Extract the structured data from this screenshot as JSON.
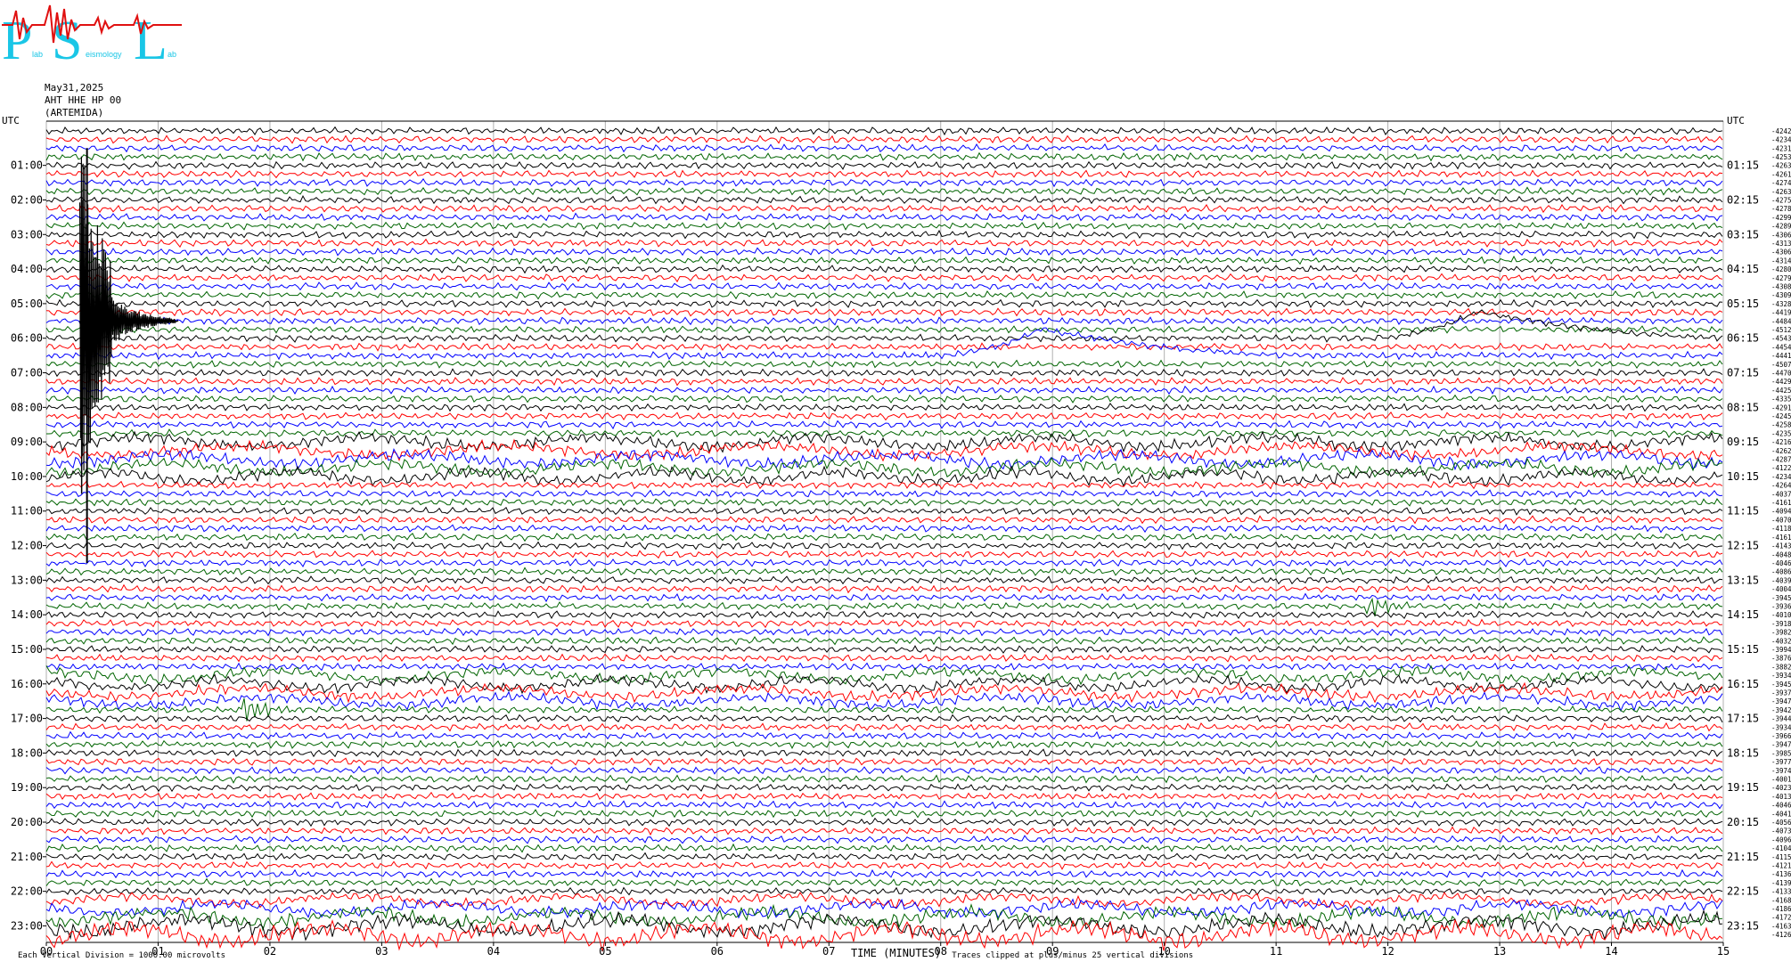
{
  "logo": {
    "big_letters": [
      "P",
      "S",
      "L"
    ],
    "small_text": [
      "lab",
      "eismology",
      "ab"
    ]
  },
  "header": {
    "date": "May31,2025",
    "station": "AHT HHE HP 00",
    "site": "(ARTEMIDA)"
  },
  "chart_data": {
    "type": "line",
    "title": "",
    "left_axis_title": "UTC",
    "right_axis_title": "UTC",
    "xlabel": "TIME (MINUTES)",
    "xlim": [
      0,
      15
    ],
    "x_ticks": [
      "00",
      "01",
      "02",
      "03",
      "04",
      "05",
      "06",
      "07",
      "08",
      "09",
      "10",
      "11",
      "12",
      "13",
      "14",
      "15"
    ],
    "hours": [
      "01:00",
      "02:00",
      "03:00",
      "04:00",
      "05:00",
      "06:00",
      "07:00",
      "08:00",
      "09:00",
      "10:00",
      "11:00",
      "12:00",
      "13:00",
      "14:00",
      "15:00",
      "16:00",
      "17:00",
      "18:00",
      "19:00",
      "20:00",
      "21:00",
      "22:00",
      "23:00"
    ],
    "right_hours": [
      "01:15",
      "02:15",
      "03:15",
      "04:15",
      "05:15",
      "06:15",
      "07:15",
      "08:15",
      "09:15",
      "10:15",
      "11:15",
      "12:15",
      "13:15",
      "14:15",
      "15:15",
      "16:15",
      "17:15",
      "18:15",
      "19:15",
      "20:15",
      "21:15",
      "22:15",
      "23:15"
    ],
    "trace_offsets": [
      -4242,
      -4234,
      -4231,
      -4253,
      -4263,
      -4261,
      -4274,
      -4263,
      -4275,
      -4278,
      -4299,
      -4289,
      -4306,
      -4313,
      -4306,
      -4314,
      -4280,
      -4279,
      -4308,
      -4309,
      -4328,
      -4419,
      -4484,
      -4512,
      -4543,
      -4454,
      -4441,
      -4507,
      -4470,
      -4429,
      -4425,
      -4335,
      -4291,
      -4245,
      -4258,
      -4235,
      -4216,
      -4262,
      -4287,
      -4122,
      -4234,
      -4264,
      -4037,
      -4161,
      -4094,
      -4070,
      -4118,
      -4161,
      -4143,
      -4048,
      -4046,
      -4086,
      -4039,
      -4004,
      -3945,
      -3936,
      -4010,
      -3918,
      -3982,
      -4032,
      -3994,
      -3876,
      -3882,
      -3934,
      -3945,
      -3937,
      -3947,
      -3942,
      -3944,
      -3934,
      -3966,
      -3947,
      -3985,
      -3977,
      -3974,
      -4001,
      -4023,
      -4013,
      -4046,
      -4041,
      -4056,
      -4073,
      -4096,
      -4104,
      -4115,
      -4121,
      -4136,
      -4139,
      -4133,
      -4168,
      -4186,
      -4172,
      -4163,
      -4126
    ],
    "trace_colors": [
      "#000000",
      "#ff0000",
      "#0000ff",
      "#006400"
    ],
    "events": [
      {
        "trace": 22,
        "minute": 0.3,
        "type": "large-earthquake"
      },
      {
        "trace": 26,
        "minute": 8.9,
        "type": "red-bump"
      },
      {
        "trace": 24,
        "minute": 12.8,
        "type": "red-bump"
      },
      {
        "trace": 55,
        "minute": 11.8,
        "type": "local-event"
      },
      {
        "trace": 67,
        "minute": 1.75,
        "type": "local-event"
      }
    ],
    "footer_left": "Each Vertical Division = 1000.00 microvolts",
    "footer_right": "Traces clipped at plus/minus 25 vertical divisions",
    "grid": true
  }
}
